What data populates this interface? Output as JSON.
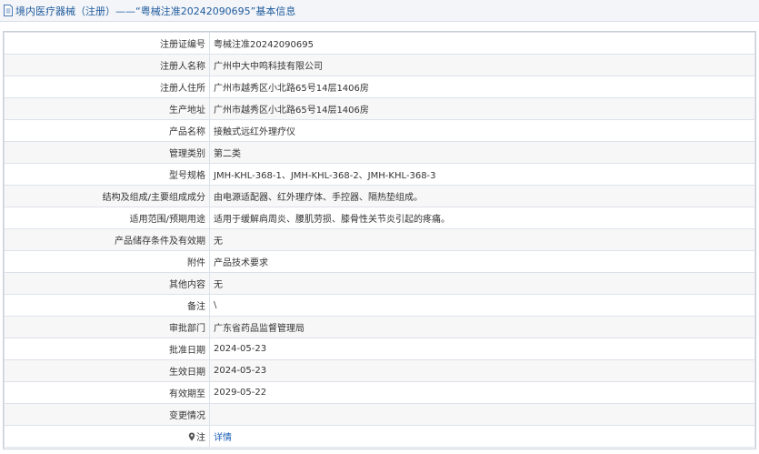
{
  "header": {
    "title": "境内医疗器械（注册）——“粤械注准20242090695”基本信息"
  },
  "rows": [
    {
      "label": "注册证编号",
      "value": "粤械注准20242090695"
    },
    {
      "label": "注册人名称",
      "value": "广州中大中鸣科技有限公司"
    },
    {
      "label": "注册人住所",
      "value": "广州市越秀区小北路65号14层1406房"
    },
    {
      "label": "生产地址",
      "value": "广州市越秀区小北路65号14层1406房"
    },
    {
      "label": "产品名称",
      "value": "接触式远红外理疗仪"
    },
    {
      "label": "管理类别",
      "value": "第二类"
    },
    {
      "label": "型号规格",
      "value": "JMH-KHL-368-1、JMH-KHL-368-2、JMH-KHL-368-3"
    },
    {
      "label": "结构及组成/主要组成成分",
      "value": "由电源适配器、红外理疗体、手控器、隔热垫组成。"
    },
    {
      "label": "适用范围/预期用途",
      "value": "适用于缓解肩周炎、腰肌劳损、膝骨性关节炎引起的疼痛。"
    },
    {
      "label": "产品储存条件及有效期",
      "value": "无"
    },
    {
      "label": "附件",
      "value": "产品技术要求"
    },
    {
      "label": "其他内容",
      "value": "无"
    },
    {
      "label": "备注",
      "value": "\\"
    },
    {
      "label": "审批部门",
      "value": "广东省药品监督管理局"
    },
    {
      "label": "批准日期",
      "value": "2024-05-23"
    },
    {
      "label": "生效日期",
      "value": "2024-05-23"
    },
    {
      "label": "有效期至",
      "value": "2029-05-22"
    },
    {
      "label": "变更情况",
      "value": ""
    },
    {
      "label": "注",
      "value": "详情",
      "icon": "note-pin-icon",
      "link": true
    }
  ]
}
